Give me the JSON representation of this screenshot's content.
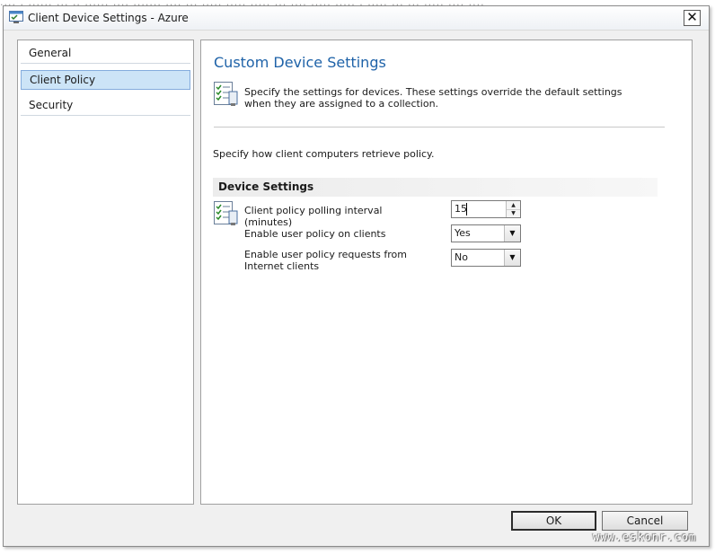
{
  "window": {
    "title": "Client Device Settings  - Azure",
    "close_label": "✕"
  },
  "sidebar": {
    "items": [
      {
        "label": "General"
      },
      {
        "label": "Client Policy",
        "selected": true
      },
      {
        "label": "Security"
      }
    ]
  },
  "main": {
    "title": "Custom Device Settings",
    "description": "Specify the settings for devices. These settings override the default settings when they are assigned to a collection.",
    "intro": "Specify how client computers retrieve policy.",
    "section_title": "Device Settings",
    "settings": [
      {
        "label": "Client policy polling interval (minutes)",
        "value": "15",
        "control": "spinner"
      },
      {
        "label": "Enable user policy on clients",
        "value": "Yes",
        "control": "dropdown"
      },
      {
        "label": "Enable user policy requests from Internet clients",
        "value": "No",
        "control": "dropdown"
      }
    ]
  },
  "footer": {
    "ok_label": "OK",
    "cancel_label": "Cancel"
  },
  "watermark": "www.eskonr.com",
  "icons": {
    "app": "settings-window-icon",
    "description": "checklist-document-icon",
    "setting": "checklist-document-icon"
  },
  "colors": {
    "title_blue": "#1e62a8",
    "selection": "#cce4f7"
  }
}
